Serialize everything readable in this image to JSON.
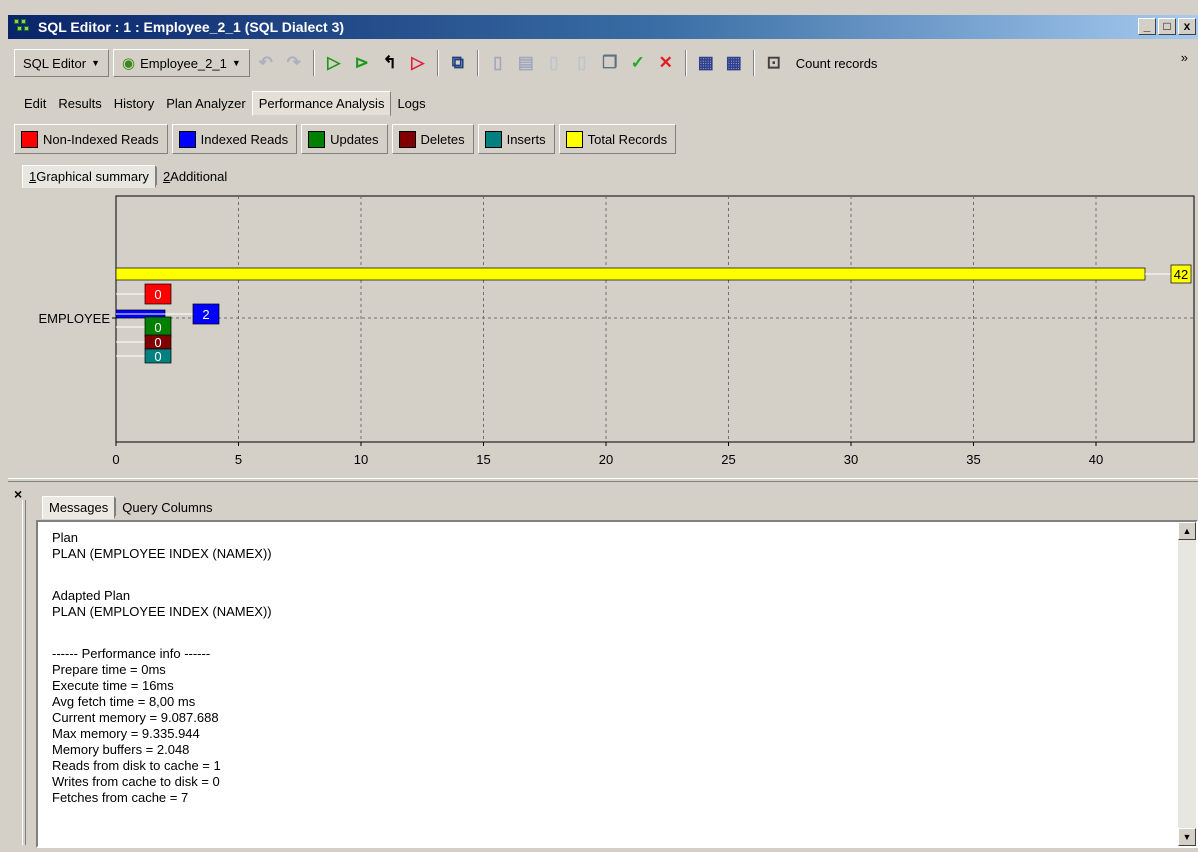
{
  "window": {
    "title": "SQL Editor : 1 : Employee_2_1 (SQL Dialect 3)",
    "btn_min": "_",
    "btn_max": "□",
    "btn_close": "x"
  },
  "toolbar": {
    "editor_label": "SQL Editor",
    "db_label": "Employee_2_1",
    "count_records": "Count records",
    "overflow": "»"
  },
  "tabs": [
    "Edit",
    "Results",
    "History",
    "Plan Analyzer",
    "Performance Analysis",
    "Logs"
  ],
  "legend": [
    {
      "label": "Non-Indexed Reads",
      "color": "#ff0000"
    },
    {
      "label": "Indexed Reads",
      "color": "#0000ff"
    },
    {
      "label": "Updates",
      "color": "#008000"
    },
    {
      "label": "Deletes",
      "color": "#800000"
    },
    {
      "label": "Inserts",
      "color": "#008080"
    },
    {
      "label": "Total Records",
      "color": "#ffff00"
    }
  ],
  "subtabs": [
    {
      "num": "1",
      "label": "Graphical summary"
    },
    {
      "num": "2",
      "label": "Additional"
    }
  ],
  "chart_data": {
    "type": "bar",
    "orientation": "horizontal",
    "categories": [
      "EMPLOYEE"
    ],
    "series": [
      {
        "name": "Total Records",
        "values": [
          42
        ],
        "color": "#ffff00"
      },
      {
        "name": "Non-Indexed Reads",
        "values": [
          0
        ],
        "color": "#ff0000"
      },
      {
        "name": "Indexed Reads",
        "values": [
          2
        ],
        "color": "#0000ff"
      },
      {
        "name": "Updates",
        "values": [
          0
        ],
        "color": "#008000"
      },
      {
        "name": "Deletes",
        "values": [
          0
        ],
        "color": "#800000"
      },
      {
        "name": "Inserts",
        "values": [
          0
        ],
        "color": "#008080"
      }
    ],
    "xlim": [
      0,
      44
    ],
    "xticks": [
      0,
      5,
      10,
      15,
      20,
      25,
      30,
      35,
      40
    ],
    "grid": true
  },
  "bottom_tabs": [
    "Messages",
    "Query Columns"
  ],
  "close_symbol": "×",
  "messages": [
    "Plan",
    "PLAN (EMPLOYEE INDEX (NAMEX))",
    "",
    "Adapted Plan",
    "PLAN (EMPLOYEE INDEX (NAMEX))",
    "",
    "------ Performance info ------",
    "Prepare time = 0ms",
    "Execute time = 16ms",
    "Avg fetch time = 8,00 ms",
    "Current memory = 9.087.688",
    "Max memory = 9.335.944",
    "Memory buffers = 2.048",
    "Reads from disk to cache = 1",
    "Writes from cache to disk = 0",
    "Fetches from cache = 7"
  ],
  "scroll_up": "▲",
  "scroll_down": "▼"
}
